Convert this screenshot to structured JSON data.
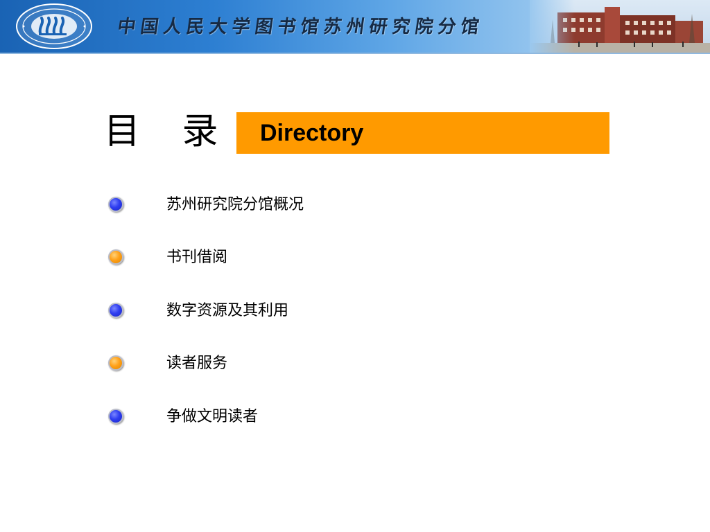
{
  "header": {
    "title": "中国人民大学图书馆苏州研究院分馆",
    "colors": {
      "banner_start": "#1a63b4",
      "banner_end": "#c9e2f7"
    },
    "logo_icon": "university-seal-icon",
    "photo": "campus-building-photo"
  },
  "slide": {
    "heading": "目 录",
    "directory_label": "Directory",
    "accent_color": "#ff9a00",
    "items": [
      {
        "label": "苏州研究院分馆概况",
        "bullet": "blue"
      },
      {
        "label": "书刊借阅",
        "bullet": "orange"
      },
      {
        "label": "数字资源及其利用",
        "bullet": "blue"
      },
      {
        "label": "读者服务",
        "bullet": "orange"
      },
      {
        "label": "争做文明读者",
        "bullet": "blue"
      }
    ]
  }
}
